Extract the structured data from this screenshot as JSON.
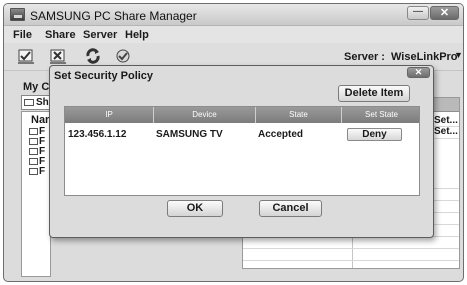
{
  "window": {
    "title": "SAMSUNG PC Share Manager"
  },
  "menu": {
    "items": [
      "File",
      "Share",
      "Server",
      "Help"
    ]
  },
  "toolbar": {
    "icons": [
      "set-folder-icon",
      "cancel-folder-icon",
      "refresh-icon",
      "apply-icon"
    ],
    "server_label": "Server :",
    "server_value": "WiseLinkPro"
  },
  "left_panel": {
    "label": "My Co",
    "combo_text": "Sh",
    "list_header": "Nar",
    "rows": [
      "F",
      "F",
      "F",
      "F",
      "F"
    ]
  },
  "right_panel": {
    "cells": [
      "Set...",
      "Set..."
    ]
  },
  "dialog": {
    "title": "Set Security Policy",
    "delete_button": "Delete Item",
    "columns": [
      "IP",
      "Device",
      "State",
      "Set State"
    ],
    "rows": [
      {
        "ip": "123.456.1.12",
        "device": "SAMSUNG TV",
        "state": "Accepted",
        "action": "Deny"
      }
    ],
    "ok_button": "OK",
    "cancel_button": "Cancel"
  }
}
